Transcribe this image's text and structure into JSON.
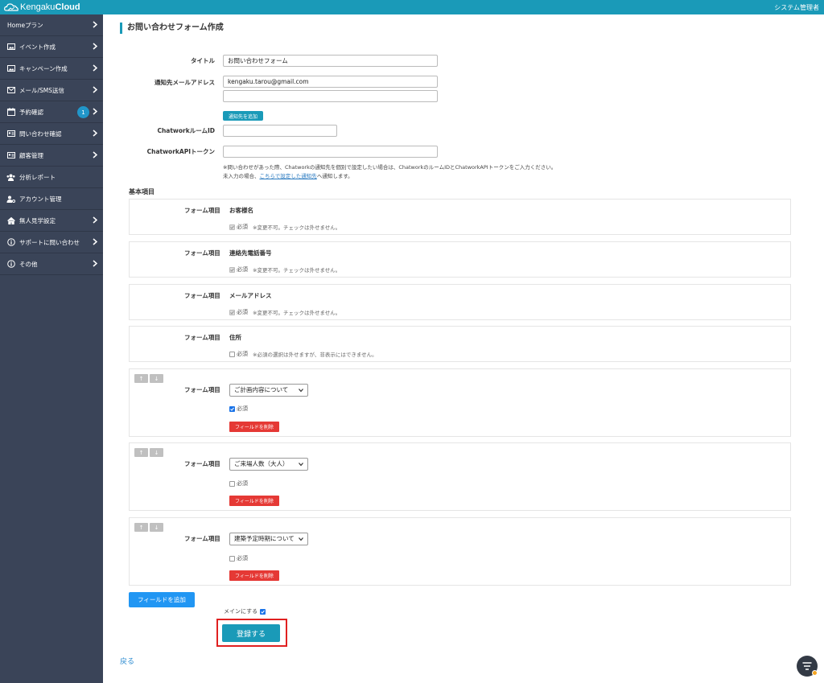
{
  "header": {
    "logo_light": "Kengaku",
    "logo_bold": "Cloud",
    "admin_label": "システム管理者"
  },
  "sidebar": {
    "items": [
      {
        "label": "Homeプラン"
      },
      {
        "label": "イベント作成"
      },
      {
        "label": "キャンペーン作成"
      },
      {
        "label": "メール/SMS送信"
      },
      {
        "label": "予約確認",
        "badge": "1"
      },
      {
        "label": "問い合わせ確認"
      },
      {
        "label": "顧客管理"
      },
      {
        "label": "分析レポート"
      },
      {
        "label": "アカウント管理"
      },
      {
        "label": "無人見学設定"
      },
      {
        "label": "サポートに問い合わせ"
      },
      {
        "label": "その他"
      }
    ]
  },
  "page": {
    "title": "お問い合わせフォーム作成",
    "title_label": "タイトル",
    "title_value": "お問い合わせフォーム",
    "email_label": "通知先メールアドレス",
    "email_value": "kengaku.tarou@gmail.com",
    "email_value_2": "",
    "add_email_button": "通知先を追加",
    "chatwork_room_label": "ChatworkルームID",
    "chatwork_room_value": "",
    "chatwork_token_label": "ChatworkAPIトークン",
    "chatwork_token_value": "",
    "note_line1": "※問い合わせがあった際、Chatworkの通知先を個別で設定したい場合は、ChatworkのルームIDとChatworkAPIトークンをご入力ください。",
    "note_line2_pre": "未入力の場合、",
    "note_line2_link": "こちらで設定した通知先",
    "note_line2_post": "へ通知します。"
  },
  "basic": {
    "section_title": "基本項目",
    "field_label": "フォーム項目",
    "required_label": "必須",
    "fixed_fields": [
      {
        "name": "お客様名",
        "note": "※変更不可。チェックは外せません。",
        "checked": true,
        "disabled": true
      },
      {
        "name": "連絡先電話番号",
        "note": "※変更不可。チェックは外せません。",
        "checked": true,
        "disabled": true
      },
      {
        "name": "メールアドレス",
        "note": "※変更不可。チェックは外せません。",
        "checked": true,
        "disabled": true
      },
      {
        "name": "住所",
        "note": "※必須の選択は外せますが、非表示にはできません。",
        "checked": false,
        "disabled": false
      }
    ],
    "custom_fields": [
      {
        "selected": "ご計画内容について",
        "required": true
      },
      {
        "selected": "ご来場人数（大人）",
        "required": false
      },
      {
        "selected": "建築予定時期について",
        "required": false
      }
    ],
    "up_arrow": "↑",
    "down_arrow": "↓",
    "delete_button": "フィールドを削除"
  },
  "footer": {
    "add_field_button": "フィールドを追加",
    "main_label": "メインにする",
    "main_checked": true,
    "submit_button": "登録する",
    "back_link": "戻る"
  },
  "colors": {
    "brand": "#1a9ab8",
    "sidebar": "#3a4458",
    "danger": "#e53935",
    "primary": "#2196f3"
  }
}
